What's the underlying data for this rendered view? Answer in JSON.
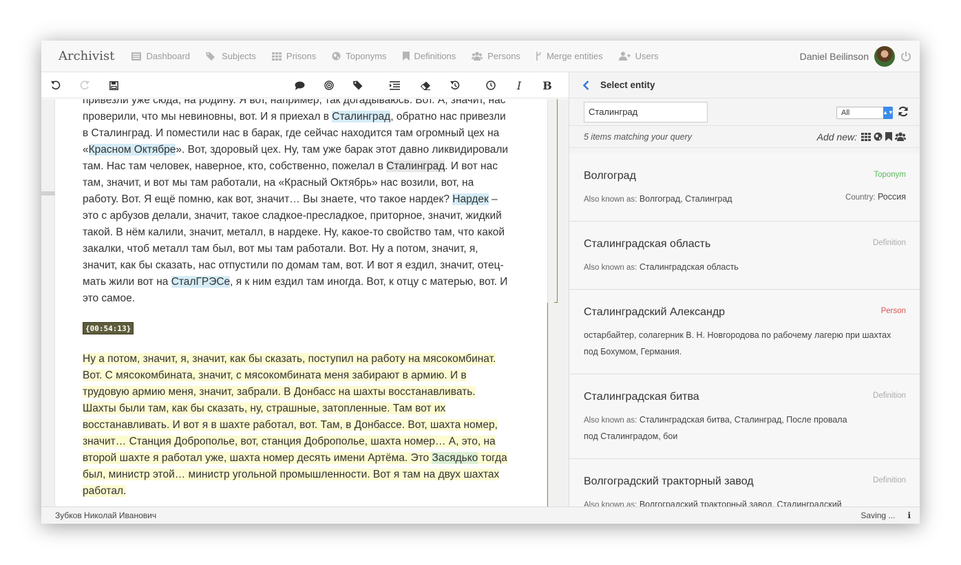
{
  "app": {
    "brand": "Archivist",
    "nav": [
      {
        "label": "Dashboard",
        "icon": "dashboard-icon"
      },
      {
        "label": "Subjects",
        "icon": "tags-icon"
      },
      {
        "label": "Prisons",
        "icon": "grid-icon"
      },
      {
        "label": "Toponyms",
        "icon": "globe-icon"
      },
      {
        "label": "Definitions",
        "icon": "bookmark-icon"
      },
      {
        "label": "Persons",
        "icon": "users-icon"
      },
      {
        "label": "Merge entities",
        "icon": "merge-icon"
      },
      {
        "label": "Users",
        "icon": "user-plus-icon"
      }
    ],
    "user_name": "Daniel Beilinson"
  },
  "toolbar": {
    "italic_label": "I",
    "bold_label": "B"
  },
  "text": {
    "para1_lines": [
      "привезли уже сюда, на родину. Я вот, например, так догадываюсь. Вот. А, значит, нас",
      "проверили, что мы невиновны, вот. И я приехал в ",
      "в Сталинград. И поместили нас в барак, где сейчас находится там огромный цех на",
      "«",
      "там. Нас там человек, наверное, кто, собственно, пожелал в ",
      "там, значит, и вот мы там работали, на «Красный Октябрь» нас возили, вот, на",
      "работу. Вот. Я ещё помню, как вот, значит… Вы знаете, что такое нардек? ",
      "это с арбузов делали, значит, такое сладкое-преcладкое, приторное, значит, жидкий",
      "такой. В нём калили, значит, металл, в нардеке. Ну, какое-то свойство там, что какой",
      "закалки, чтоб металл там был, вот мы там работали. Вот. Ну а потом, значит, я,",
      "значит, как бы сказать, нас отпустили по домам там, вот. И вот я ездил, значит, отец-",
      "мать жили вот на ",
      "это самое."
    ],
    "line2_entity": "Сталинград",
    "line2_tail": ", обратно нас привезли",
    "line4_entity": "Красном Октябре",
    "line4_tail": "». Вот, здоровый цех. Ну, там уже барак этот давно ликвидировали",
    "line5_entity": "Сталинград",
    "line5_tail": ". И вот нас",
    "line7_entity": "Нардек",
    "line7_tail": " –",
    "line12_entity": "СталГРЭСе",
    "line12_tail": ", я к ним ездил там иногда. Вот, к отцу с матерью, вот. И",
    "timecode": "{00:54:13}",
    "para2_lines": [
      "Ну а потом, значит, я, значит, как бы сказать, поступил на работу на мясокомбинат.",
      "Вот. С мясокомбината, значит, с мясокомбината меня забирают в армию. И в",
      "трудовую армию меня, значит, забрали. В Донбасс на шахты восстанавливать.",
      "Шахты были там, как бы сказать, ну, страшные, затопленные. Там вот их",
      "восстанавливать. И вот я в шахте работал, вот. Там, в Донбассе. Вот, шахта номер,",
      "значит… Станция Доброполье, вот, станция Доброполье, шахта номер… А, это, на",
      "второй шахте я работал уже, шахта номер десять имени Артёма. Это ",
      "был, министр этой… министр угольной промышленности. Вот я там на двух шахтах",
      "работал."
    ],
    "para2_line7_entity": "Засядько",
    "para2_line7_tail": " тогда"
  },
  "panel": {
    "title": "Select entity",
    "search_value": "Сталинград",
    "filter_value": "All",
    "count_text": "5 items matching your query",
    "add_new_label": "Add new:",
    "aka_label": "Also known as:",
    "results": [
      {
        "title": "Волгоград",
        "type": "Toponym",
        "type_color": "#5cb85c",
        "aka": "Волгоград, Сталинград",
        "country_label": "Country:",
        "country": "Россия"
      },
      {
        "title": "Сталинградская область",
        "type": "Definition",
        "type_color": "#aaaaaa",
        "aka": "Сталинградская область"
      },
      {
        "title": "Сталинградский Александр",
        "type": "Person",
        "type_color": "#d9534f",
        "desc1": "остарбайтер, солагерник В. Н. Новгородова по рабочему лагерю при шахтах",
        "desc2": "под Бохумом, Германия."
      },
      {
        "title": "Сталинградская битва",
        "type": "Definition",
        "type_color": "#aaaaaa",
        "aka": "Сталинградская битва, Сталинград, После провала",
        "aka2": "под Сталинградом, бои"
      },
      {
        "title": "Волгоградский тракторный завод",
        "type": "Definition",
        "type_color": "#aaaaaa",
        "aka": "Волгоградский тракторный завод, Сталинградский"
      }
    ]
  },
  "status": {
    "respondent": "Зубков Николай Иванович",
    "saving": "Saving ..."
  }
}
